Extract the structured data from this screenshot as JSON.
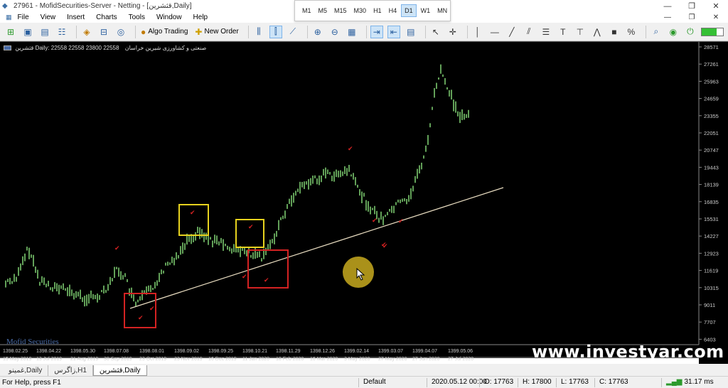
{
  "window": {
    "title": "27961 - MofidSecurities-Server - Netting - [قثشرین,Daily]"
  },
  "timeframes": [
    "M1",
    "M5",
    "M15",
    "M30",
    "H1",
    "H4",
    "D1",
    "W1",
    "MN"
  ],
  "timeframe_active": "D1",
  "menu": [
    "File",
    "View",
    "Insert",
    "Charts",
    "Tools",
    "Window",
    "Help"
  ],
  "toolbar": {
    "algo_trading": "Algo Trading",
    "new_order": "New Order"
  },
  "chart": {
    "symbol_line": "قثشرین Daily: 22558 22558 23800 22558",
    "company_name": "صنعتی و کشاورزی شیرین خراسان",
    "broker": "Mofid Securities",
    "watermark": "www.investyar.com",
    "price_ticks": [
      "28571",
      "27261",
      "25963",
      "24659",
      "23355",
      "22051",
      "20747",
      "19443",
      "18139",
      "16835",
      "15531",
      "14227",
      "12923",
      "11619",
      "10315",
      "9011",
      "7707",
      "6403"
    ],
    "date_labels_top": [
      "1398.02.25",
      "1398.04.22",
      "1398.05.30",
      "1398.07.08",
      "1398.08.01",
      "1398.09.02",
      "1398.09.25",
      "1398.10.21",
      "1398.11.29",
      "1398.12.26",
      "1399.02.14",
      "1399.03.07",
      "1399.04.07",
      "1399.05.06"
    ],
    "date_labels_bottom": [
      "15 May 2019",
      "13 Jul 2019",
      "21 Aug 2019",
      "30 Sep 2019",
      "23 Oct 2019",
      "23 Nov 2019",
      "16 Dec 2019",
      "11 Jan 2020",
      "18 Feb 2020",
      "16 Mar 2020",
      "3 May 2020",
      "27 May 2020",
      "27 Jun 2020",
      "27 Jul 2020"
    ]
  },
  "tabs": [
    {
      "label": "غمینو,Daily",
      "active": false
    },
    {
      "label": "زاگرس,H1",
      "active": false
    },
    {
      "label": "قثشرین,Daily",
      "active": true
    }
  ],
  "status": {
    "help": "For Help, press F1",
    "profile": "Default",
    "datetime": "2020.05.12 00:00",
    "open": "O: 17763",
    "high": "H: 17800",
    "low": "L: 17763",
    "close": "C: 17763",
    "traffic": "31.17 ms"
  },
  "colors": {
    "background": "#000000",
    "bar_color": "#7bc96f",
    "trendline": "#e8dcc0",
    "yellow_box": "#e6d21e",
    "red_box": "#d42222",
    "check_mark": "#d42222",
    "cursor_highlight": "#c8aa1e"
  },
  "annotations": {
    "check_mark_glyph": "✔",
    "check_count": 12
  }
}
